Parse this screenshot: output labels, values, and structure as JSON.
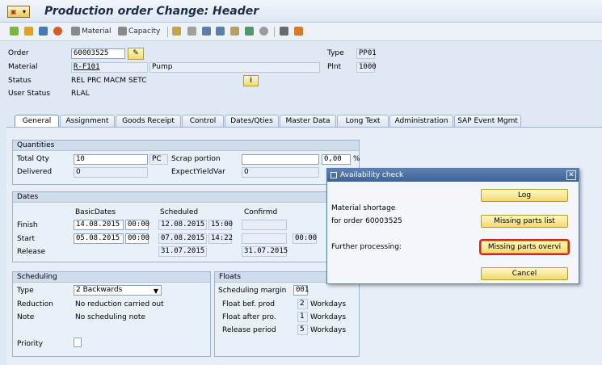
{
  "title": "Production order Change: Header",
  "toolbar": {
    "material_label": "Material",
    "capacity_label": "Capacity"
  },
  "header": {
    "order_label": "Order",
    "order_value": "60003525",
    "type_label": "Type",
    "type_value": "PP01",
    "material_label": "Material",
    "material_value": "R-F101",
    "material_desc": "Pump",
    "plnt_label": "Plnt",
    "plnt_value": "1000",
    "status_label": "Status",
    "status_value": "REL  PRC  MACM SETC",
    "user_status_label": "User Status",
    "user_status_value": "RLAL"
  },
  "tabs": [
    "General",
    "Assignment",
    "Goods Receipt",
    "Control",
    "Dates/Qties",
    "Master Data",
    "Long Text",
    "Administration",
    "SAP Event Mgmt"
  ],
  "quantities": {
    "header": "Quantities",
    "total_qty_label": "Total Qty",
    "total_qty_value": "10",
    "unit": "PC",
    "scrap_label": "Scrap portion",
    "scrap_value": "",
    "scrap_pct": "0,00",
    "pct_sign": "%",
    "delivered_label": "Delivered",
    "delivered_value": "0",
    "expect_label": "ExpectYieldVar",
    "expect_value": "0"
  },
  "dates": {
    "header": "Dates",
    "col_basic": "BasicDates",
    "col_scheduled": "Scheduled",
    "col_confirmd": "Confirmd",
    "finish_label": "Finish",
    "finish_basic_date": "14.08.2015",
    "finish_basic_time": "00:00",
    "finish_sched_date": "12.08.2015",
    "finish_sched_time": "15:00",
    "start_label": "Start",
    "start_basic_date": "05.08.2015",
    "start_basic_time": "00:00",
    "start_sched_date": "07.08.2015",
    "start_sched_time": "14:22",
    "start_conf_time": "00:00",
    "release_label": "Release",
    "release_sched_date": "31.07.2015",
    "release_conf_date": "31.07.2015"
  },
  "scheduling": {
    "header": "Scheduling",
    "type_label": "Type",
    "type_value": "2 Backwards",
    "reduction_label": "Reduction",
    "reduction_value": "No reduction carried out",
    "note_label": "Note",
    "note_value": "No scheduling note",
    "priority_label": "Priority"
  },
  "floats": {
    "header": "Floats",
    "margin_label": "Scheduling margin",
    "margin_value": "001",
    "bef_label": "Float bef. prod",
    "bef_value": "2",
    "bef_unit": "Workdays",
    "after_label": "Float after pro.",
    "after_value": "1",
    "after_unit": "Workdays",
    "release_label": "Release period",
    "release_value": "5",
    "release_unit": "Workdays"
  },
  "dialog": {
    "title": "Availability check",
    "line1": "Material shortage",
    "line2": "for order 60003525",
    "further": "Further processing:",
    "btn_log": "Log",
    "btn_missing_list": "Missing parts list",
    "btn_missing_overview": "Missing parts overvi",
    "btn_cancel": "Cancel"
  }
}
